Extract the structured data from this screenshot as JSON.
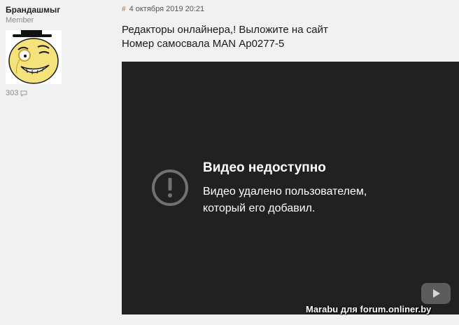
{
  "author": {
    "name": "Брандашмыг",
    "role": "Member",
    "posts": "303"
  },
  "post": {
    "date": "4 октября 2019 20:21",
    "lines": [
      "Редакторы онлайнера,! Выложите на сайт",
      "Номер самосвала MAN Ар0277-5"
    ]
  },
  "video": {
    "title": "Видео недоступно",
    "message": [
      "Видео удалено пользователем,",
      "который его добавил."
    ]
  },
  "watermark": "Marabu для forum.onliner.by",
  "icons": {
    "post_count": "comment-icon",
    "permalink": "hash-icon",
    "alert": "alert-circle-icon",
    "youtube": "youtube-play-icon"
  },
  "colors": {
    "page_bg": "#f1f1f1",
    "video_bg": "#212121",
    "permalink": "#e8734a"
  }
}
